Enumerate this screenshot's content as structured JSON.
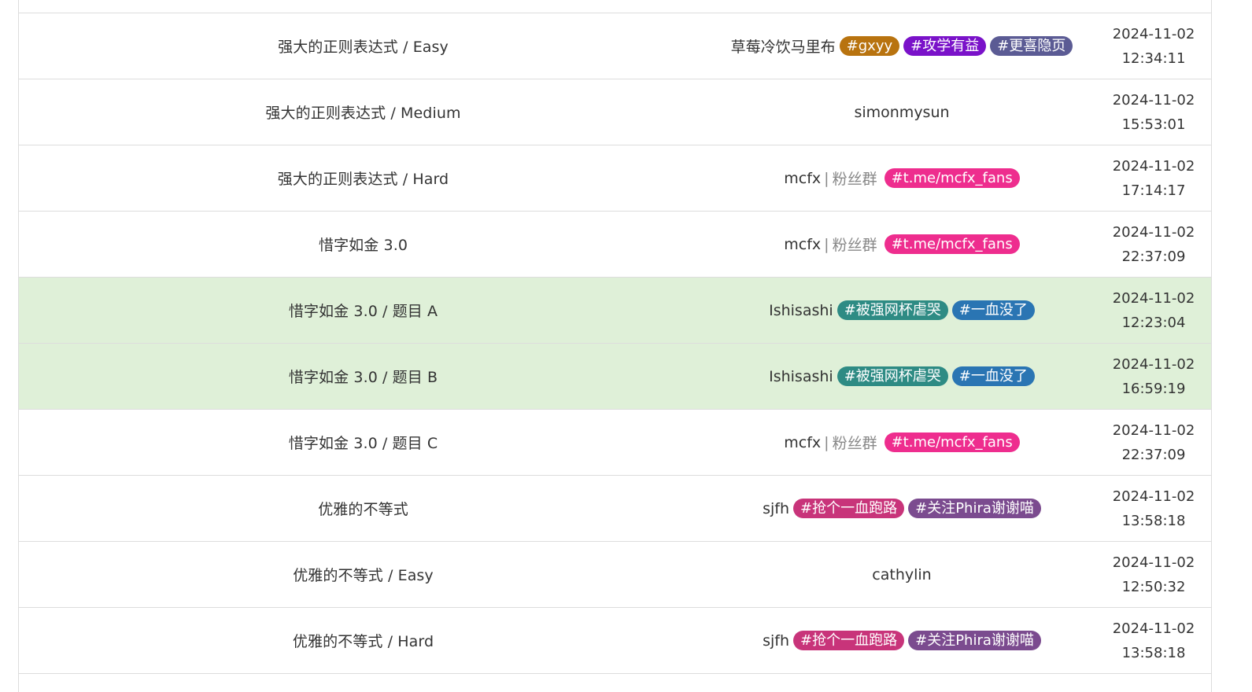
{
  "rows": [
    {
      "title": "强大的正则表达式 / Easy",
      "author": "草莓冷饮马里布",
      "fan": false,
      "tags": [
        {
          "text": "#gxyy",
          "color": "#b8730f"
        },
        {
          "text": "#攻学有益",
          "color": "#7a12c9"
        },
        {
          "text": "#更喜隐页",
          "color": "#5b5b94"
        }
      ],
      "date": "2024-11-02",
      "time": "12:34:11",
      "highlight": false
    },
    {
      "title": "强大的正则表达式 / Medium",
      "author": "simonmysun",
      "fan": false,
      "tags": [],
      "date": "2024-11-02",
      "time": "15:53:01",
      "highlight": false
    },
    {
      "title": "强大的正则表达式 / Hard",
      "author": "mcfx",
      "fan": true,
      "tags": [
        {
          "text": "#t.me/mcfx_fans",
          "color": "#ee2d8e"
        }
      ],
      "date": "2024-11-02",
      "time": "17:14:17",
      "highlight": false
    },
    {
      "title": "惜字如金 3.0",
      "author": "mcfx",
      "fan": true,
      "tags": [
        {
          "text": "#t.me/mcfx_fans",
          "color": "#ee2d8e"
        }
      ],
      "date": "2024-11-02",
      "time": "22:37:09",
      "highlight": false
    },
    {
      "title": "惜字如金 3.0 / 题目 A",
      "author": "Ishisashi",
      "fan": false,
      "tags": [
        {
          "text": "#被强网杯虐哭",
          "color": "#2e8b84"
        },
        {
          "text": "#一血没了",
          "color": "#2a75b3"
        }
      ],
      "date": "2024-11-02",
      "time": "12:23:04",
      "highlight": true
    },
    {
      "title": "惜字如金 3.0 / 题目 B",
      "author": "Ishisashi",
      "fan": false,
      "tags": [
        {
          "text": "#被强网杯虐哭",
          "color": "#2e8b84"
        },
        {
          "text": "#一血没了",
          "color": "#2a75b3"
        }
      ],
      "date": "2024-11-02",
      "time": "16:59:19",
      "highlight": true
    },
    {
      "title": "惜字如金 3.0 / 题目 C",
      "author": "mcfx",
      "fan": true,
      "tags": [
        {
          "text": "#t.me/mcfx_fans",
          "color": "#ee2d8e"
        }
      ],
      "date": "2024-11-02",
      "time": "22:37:09",
      "highlight": false
    },
    {
      "title": "优雅的不等式",
      "author": "sjfh",
      "fan": false,
      "tags": [
        {
          "text": "#抢个一血跑路",
          "color": "#c8347a"
        },
        {
          "text": "#关注Phira谢谢喵",
          "color": "#7b4b8f"
        }
      ],
      "date": "2024-11-02",
      "time": "13:58:18",
      "highlight": false
    },
    {
      "title": "优雅的不等式 / Easy",
      "author": "cathylin",
      "fan": false,
      "tags": [],
      "date": "2024-11-02",
      "time": "12:50:32",
      "highlight": false
    },
    {
      "title": "优雅的不等式 / Hard",
      "author": "sjfh",
      "fan": false,
      "tags": [
        {
          "text": "#抢个一血跑路",
          "color": "#c8347a"
        },
        {
          "text": "#关注Phira谢谢喵",
          "color": "#7b4b8f"
        }
      ],
      "date": "2024-11-02",
      "time": "13:58:18",
      "highlight": false
    }
  ],
  "fan_label": "粉丝群",
  "separator": "|",
  "colors": {
    "border": "#dddddd",
    "highlight_bg": "#dff0d8",
    "muted_text": "#888888"
  }
}
